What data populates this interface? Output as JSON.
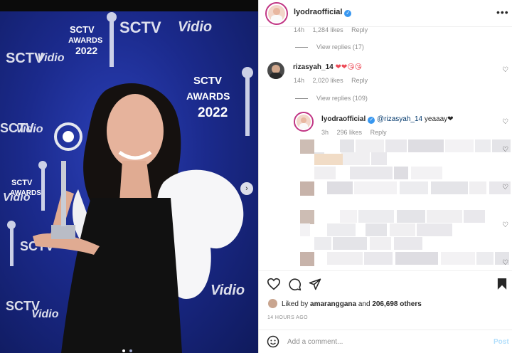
{
  "post": {
    "dots_count": 2,
    "active_dot": 0,
    "watermarks": [
      "SCTV",
      "Vidio",
      "SCTV",
      "Vidio",
      "SCTV",
      "Vidio",
      "SCTV",
      "Vidio",
      "SCTV",
      "Vidio",
      "Vidio"
    ],
    "award_logo": [
      "SCTV",
      "AWARDS",
      "2022"
    ],
    "colors": {
      "backdrop": "#1b2a8c",
      "dress": "#111111",
      "sleeve": "#f6f6f8",
      "dot_active": "#ffffff",
      "dot_inactive": "#9aa3c9"
    }
  },
  "header": {
    "username": "lyodraofficial"
  },
  "comments": [
    {
      "time": "14h",
      "likes": "1,284 likes",
      "reply_label": "Reply",
      "view_replies": "View replies (17)"
    },
    {
      "username": "rizasyah_14",
      "text": "❤❤😘😘",
      "time": "14h",
      "likes": "2,020 likes",
      "reply_label": "Reply",
      "view_replies": "View replies (109)",
      "reply": {
        "username": "lyodraofficial",
        "mention": "@rizasyah_14",
        "text": " yeaaay❤",
        "time": "3h",
        "likes": "296 likes",
        "reply_label": "Reply"
      }
    }
  ],
  "actions": {
    "liked_by_prefix": "Liked by ",
    "liked_by_user": "amaranggana",
    "liked_by_and": " and ",
    "liked_by_count": "206,698 others",
    "time_ago": "14 HOURS AGO"
  },
  "add_comment": {
    "placeholder": "Add a comment...",
    "post_label": "Post"
  },
  "colors": {
    "accent": "#3897f0",
    "heart": "#ed4956",
    "muted": "#8e8e8e",
    "ring": "#c13584"
  }
}
